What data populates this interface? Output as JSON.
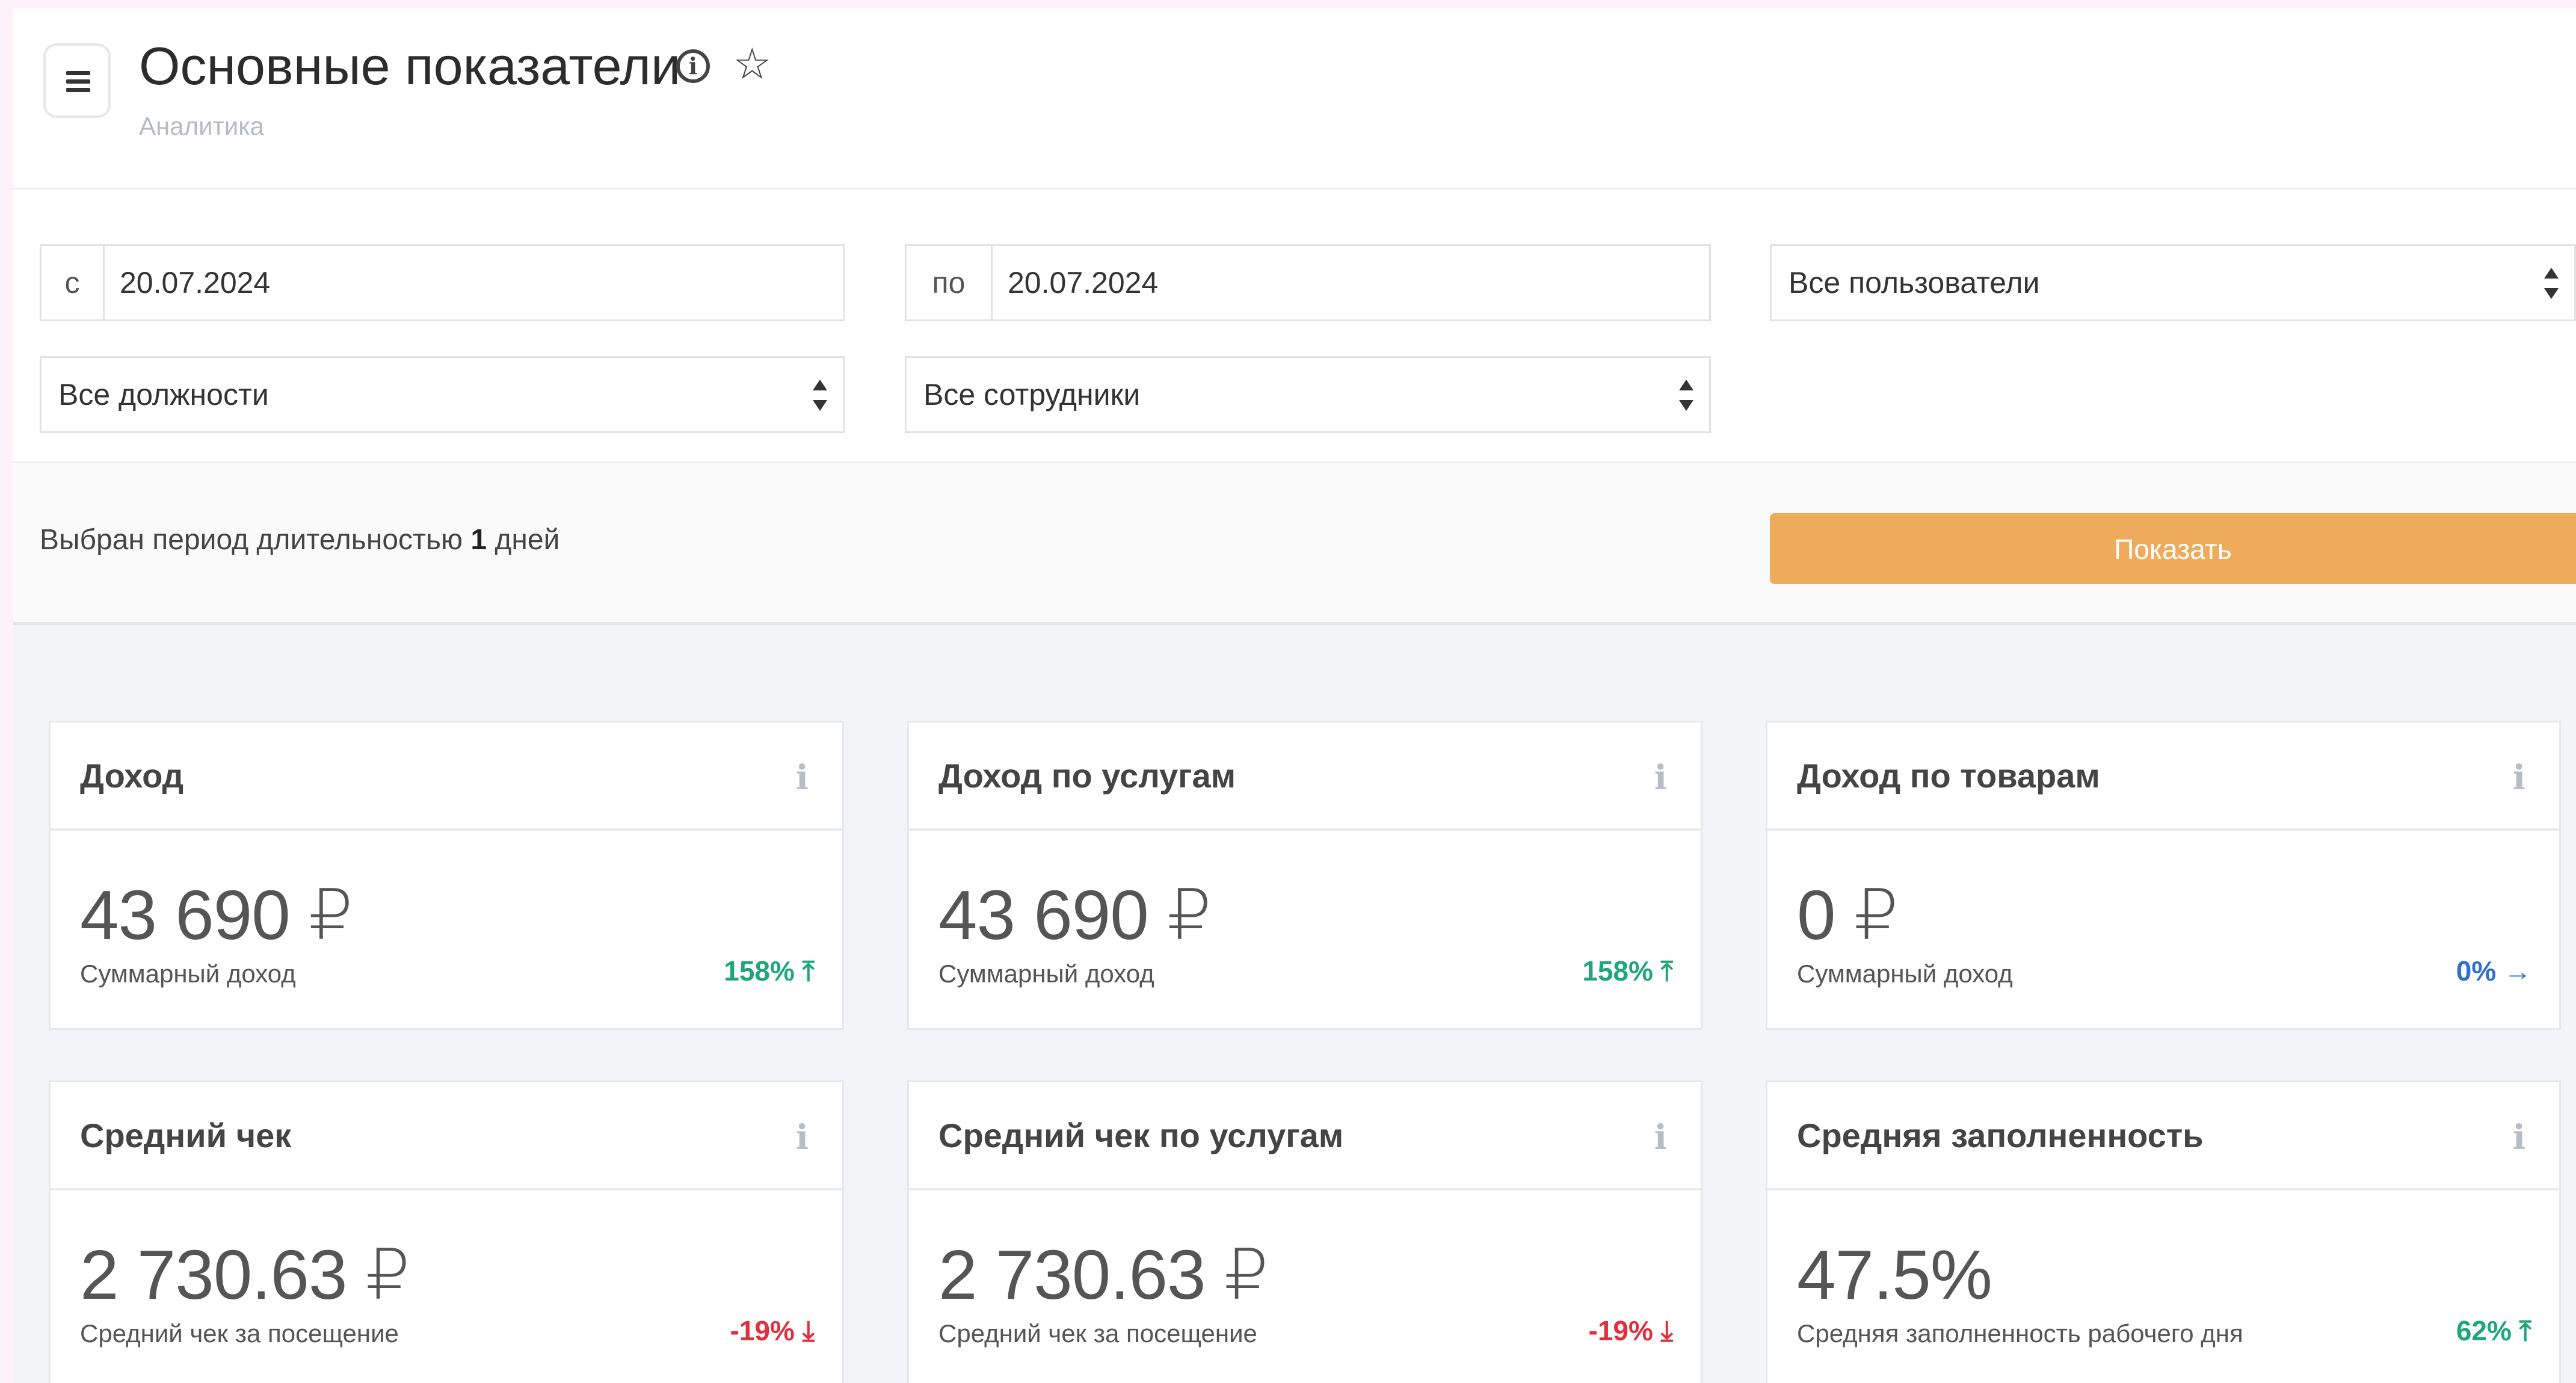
{
  "header": {
    "title": "Основные показатели",
    "breadcrumb": "Аналитика"
  },
  "filters": {
    "from_prefix": "с",
    "from_date": "20.07.2024",
    "to_prefix": "по",
    "to_date": "20.07.2024",
    "users_select": "Все пользователи",
    "positions_select": "Все должности",
    "employees_select": "Все сотрудники"
  },
  "period": {
    "text_before": "Выбран период длительностью",
    "days": "1",
    "text_after": "дней"
  },
  "show_button": "Показать",
  "colors": {
    "accent_button": "#efab5c",
    "positive": "#1fa67a",
    "negative": "#e0303e",
    "neutral": "#2f6fd0"
  },
  "cards": [
    {
      "title": "Доход",
      "value": "43 690 ₽",
      "subtitle": "Суммарный доход",
      "delta": "158% ⤒",
      "trend": "up"
    },
    {
      "title": "Доход по услугам",
      "value": "43 690 ₽",
      "subtitle": "Суммарный доход",
      "delta": "158% ⤒",
      "trend": "up"
    },
    {
      "title": "Доход по товарам",
      "value": "0 ₽",
      "subtitle": "Суммарный доход",
      "delta": "0% →",
      "trend": "flat"
    },
    {
      "title": "Средний чек",
      "value": "2 730.63 ₽",
      "subtitle": "Средний чек за посещение",
      "delta": "-19% ⤓",
      "trend": "down"
    },
    {
      "title": "Средний чек по услугам",
      "value": "2 730.63 ₽",
      "subtitle": "Средний чек за посещение",
      "delta": "-19% ⤓",
      "trend": "down"
    },
    {
      "title": "Средняя заполненность",
      "value": "47.5%",
      "subtitle": "Средняя заполненность рабочего дня",
      "delta": "62% ⤒",
      "trend": "up"
    }
  ]
}
